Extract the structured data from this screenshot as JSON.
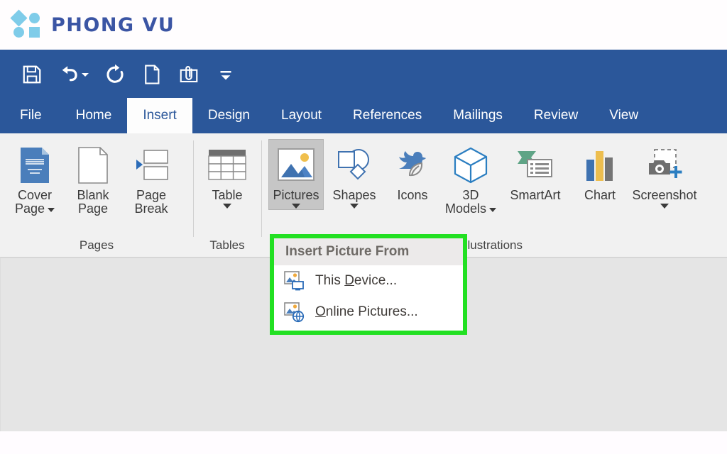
{
  "brand": {
    "name": "PHONG VU",
    "logo_icon": "phong-vu-logo-shapes",
    "logo_color": "#7fcce9",
    "text_color": "#3b55a4"
  },
  "quick_access_toolbar": {
    "items": [
      {
        "name": "save",
        "icon": "floppy-disk-icon",
        "has_dropdown": false
      },
      {
        "name": "undo",
        "icon": "undo-arrow-icon",
        "has_dropdown": true
      },
      {
        "name": "redo",
        "icon": "redo-arrow-icon",
        "has_dropdown": false
      },
      {
        "name": "new-document",
        "icon": "new-document-icon",
        "has_dropdown": false
      },
      {
        "name": "email-attachment",
        "icon": "paperclip-envelope-icon",
        "has_dropdown": false
      },
      {
        "name": "customize-toolbar",
        "icon": "customize-chevron-icon",
        "has_dropdown": false
      }
    ]
  },
  "ribbon": {
    "accent_color": "#2b579a",
    "tabs": [
      {
        "label": "File",
        "active": false
      },
      {
        "label": "Home",
        "active": false
      },
      {
        "label": "Insert",
        "active": true
      },
      {
        "label": "Design",
        "active": false
      },
      {
        "label": "Layout",
        "active": false
      },
      {
        "label": "References",
        "active": false
      },
      {
        "label": "Mailings",
        "active": false
      },
      {
        "label": "Review",
        "active": false
      },
      {
        "label": "View",
        "active": false
      }
    ],
    "groups": [
      {
        "label": "Pages",
        "buttons": [
          {
            "label_line1": "Cover",
            "label_line2": "Page",
            "icon": "cover-page-icon",
            "has_caret_inline": true,
            "has_caret_row": false,
            "active": false
          },
          {
            "label_line1": "Blank",
            "label_line2": "Page",
            "icon": "blank-page-icon",
            "has_caret_inline": false,
            "has_caret_row": false,
            "active": false
          },
          {
            "label_line1": "Page",
            "label_line2": "Break",
            "icon": "page-break-icon",
            "has_caret_inline": false,
            "has_caret_row": false,
            "active": false
          }
        ]
      },
      {
        "label": "Tables",
        "buttons": [
          {
            "label_line1": "Table",
            "label_line2": "",
            "icon": "table-icon",
            "has_caret_inline": false,
            "has_caret_row": true,
            "active": false
          }
        ]
      },
      {
        "label": "Illustrations",
        "buttons": [
          {
            "label_line1": "Pictures",
            "label_line2": "",
            "icon": "pictures-icon",
            "has_caret_inline": false,
            "has_caret_row": true,
            "active": true
          },
          {
            "label_line1": "Shapes",
            "label_line2": "",
            "icon": "shapes-icon",
            "has_caret_inline": false,
            "has_caret_row": true,
            "active": false
          },
          {
            "label_line1": "Icons",
            "label_line2": "",
            "icon": "icons-bird-leaf-icon",
            "has_caret_inline": false,
            "has_caret_row": false,
            "active": false
          },
          {
            "label_line1": "3D",
            "label_line2": "Models",
            "icon": "3d-models-cube-icon",
            "has_caret_inline": true,
            "has_caret_row": false,
            "active": false
          },
          {
            "label_line1": "SmartArt",
            "label_line2": "",
            "icon": "smartart-icon",
            "has_caret_inline": false,
            "has_caret_row": false,
            "active": false
          },
          {
            "label_line1": "Chart",
            "label_line2": "",
            "icon": "chart-icon",
            "has_caret_inline": false,
            "has_caret_row": false,
            "active": false
          },
          {
            "label_line1": "Screenshot",
            "label_line2": "",
            "icon": "screenshot-camera-icon",
            "has_caret_inline": false,
            "has_caret_row": true,
            "active": false
          }
        ]
      }
    ]
  },
  "dropdown": {
    "header": "Insert Picture From",
    "highlight_color": "#22e022",
    "items": [
      {
        "label_pre": "This ",
        "label_key": "D",
        "label_post": "evice...",
        "icon": "picture-device-icon"
      },
      {
        "label_pre": "",
        "label_key": "O",
        "label_post": "nline Pictures...",
        "icon": "picture-online-globe-icon"
      }
    ]
  }
}
